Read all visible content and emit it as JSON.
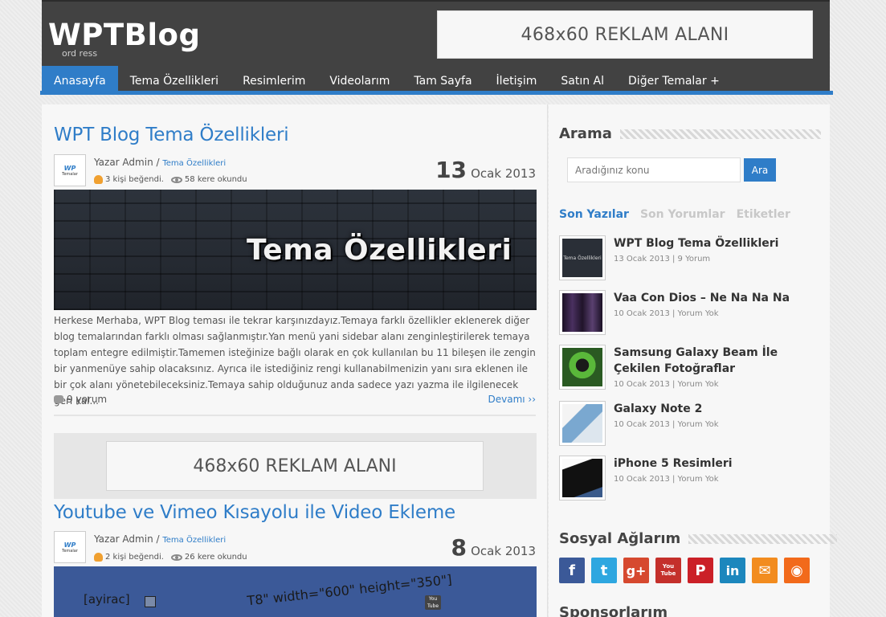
{
  "header": {
    "logo": "WPTBlog",
    "logo_sub": "ord ress",
    "ad": "468x60 REKLAM ALANI"
  },
  "nav": [
    {
      "label": "Anasayfa",
      "active": true
    },
    {
      "label": "Tema Özellikleri"
    },
    {
      "label": "Resimlerim"
    },
    {
      "label": "Videolarım"
    },
    {
      "label": "Tam Sayfa"
    },
    {
      "label": "İletişim"
    },
    {
      "label": "Satın Al"
    },
    {
      "label": "Diğer Temalar +"
    }
  ],
  "posts": [
    {
      "title": "WPT Blog Tema Özellikleri",
      "author": "Yazar Admin",
      "category": "Tema Özellikleri",
      "likes": "3 kişi beğendi.",
      "views": "58 kere okundu",
      "day": "13",
      "month_year": "Ocak 2013",
      "image_text": "Tema Özellikleri",
      "excerpt": "Herkese Merhaba, WPT Blog teması ile tekrar karşınızdayız.Temaya farklı özellikler eklenerek diğer blog temalarından farklı olması sağlanmıştır.Yan menü yani sidebar alanı zenginleştirilerek temaya toplam entegre edilmiştir.Tamemen isteğinize bağlı olarak en çok kullanılan bu 11 bileşen ile zengin bir yanmenüye sahip olacaksınız. Ayrıca ile istediğiniz rengi kullanabilmenizin yanı sıra eklenen ile bir çok alanı yönetebileceksiniz.Temaya sahip olduğunuz anda sadece yazı yazma ile ilgilenecek geri kal...",
      "comments": "9 yorum",
      "more": "Devamı ››"
    },
    {
      "title": "Youtube ve Vimeo Kısayolu ile Video Ekleme",
      "author": "Yazar Admin",
      "category": "Tema Özellikleri",
      "likes": "2 kişi beğendi.",
      "views": "26 kere okundu",
      "day": "8",
      "month_year": "Ocak 2013",
      "code1": "[ayirac]",
      "code2": "T8\" width=\"600\" height=\"350\"]",
      "yt_label": "You Tube"
    }
  ],
  "avatar": {
    "wp": "WP",
    "tm": "Temalar"
  },
  "mid_ad": "468x60 REKLAM ALANI",
  "sidebar": {
    "search_title": "Arama",
    "search_placeholder": "Aradığınız konu",
    "search_button": "Ara",
    "tabs": [
      {
        "label": "Son Yazılar",
        "active": true
      },
      {
        "label": "Son Yorumlar"
      },
      {
        "label": "Etiketler"
      }
    ],
    "recent": [
      {
        "title": "WPT Blog Tema Özellikleri",
        "meta": "13 Ocak 2013 | 9 Yorum",
        "thumb_text": "Tema Özellikleri"
      },
      {
        "title": "Vaa Con Dios – Ne Na Na Na",
        "meta": "10 Ocak 2013 | Yorum Yok"
      },
      {
        "title": "Samsung Galaxy Beam İle Çekilen Fotoğraflar",
        "meta": "10 Ocak 2013 | Yorum Yok"
      },
      {
        "title": "Galaxy Note 2",
        "meta": "10 Ocak 2013 | Yorum Yok"
      },
      {
        "title": "iPhone 5 Resimleri",
        "meta": "10 Ocak 2013 | Yorum Yok"
      }
    ],
    "social_title": "Sosyal Ağlarım",
    "social": [
      {
        "name": "facebook-icon",
        "glyph": "f",
        "color": "#3b5998"
      },
      {
        "name": "twitter-icon",
        "glyph": "t",
        "color": "#2ea7e0"
      },
      {
        "name": "google-plus-icon",
        "glyph": "g+",
        "color": "#d6492f"
      },
      {
        "name": "youtube-icon",
        "glyph": "You Tube",
        "color": "#c4302b"
      },
      {
        "name": "pinterest-icon",
        "glyph": "P",
        "color": "#cb2027"
      },
      {
        "name": "linkedin-icon",
        "glyph": "in",
        "color": "#1c87bd"
      },
      {
        "name": "mail-icon",
        "glyph": "✉",
        "color": "#f28c1f"
      },
      {
        "name": "rss-icon",
        "glyph": "◉",
        "color": "#f26a1b"
      }
    ],
    "sponsor_title": "Sponsorlarım"
  }
}
